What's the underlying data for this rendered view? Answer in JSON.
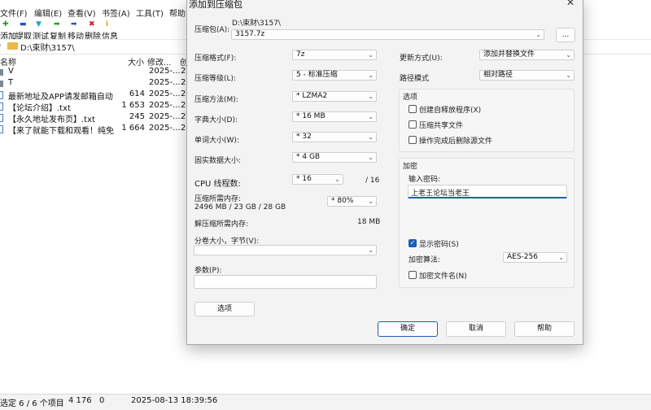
{
  "fm": {
    "menu": [
      "文件(F)",
      "编辑(E)",
      "查看(V)",
      "书签(A)",
      "工具(T)",
      "帮助"
    ],
    "toolbar": [
      "添加",
      "提取",
      "测试",
      "复制",
      "移动",
      "删除",
      "信息"
    ],
    "address": "D:\\束财\\3157\\",
    "columns": {
      "name": "名称",
      "size": "大小",
      "modified": "修改...",
      "created": "创"
    },
    "files": [
      {
        "name": "V",
        "size": "",
        "modified": "2025-...",
        "created": "2"
      },
      {
        "name": "T",
        "size": "",
        "modified": "2025-...",
        "created": "2"
      },
      {
        "name": "最新地址及APP请发邮箱自动...",
        "size": "614",
        "modified": "2025-...",
        "created": "2"
      },
      {
        "name": "【论坛介绍】.txt",
        "size": "1 653",
        "modified": "2025-...",
        "created": "2"
      },
      {
        "name": "【永久地址发布页】.txt",
        "size": "245",
        "modified": "2025-...",
        "created": "2"
      },
      {
        "name": "【来了就能下载和观看！纯免...",
        "size": "1 664",
        "modified": "2025-...",
        "created": "2"
      }
    ],
    "status": {
      "selected": "选定 6 / 6 个项目",
      "size": "4 176",
      "zero": "0",
      "datetime": "2025-08-13 18:39:56"
    }
  },
  "dialog": {
    "title": "添加到压缩包",
    "archive_label": "压缩包(A):",
    "archive_path": "D:\\束财\\3157\\",
    "archive_name": "3157.7z",
    "browse_label": "...",
    "format_label": "压缩格式(F):",
    "format_value": "7z",
    "level_label": "压缩等级(L):",
    "level_value": "5 - 标准压缩",
    "method_label": "压缩方法(M):",
    "method_value": "* LZMA2",
    "dict_label": "字典大小(D):",
    "dict_value": "* 16 MB",
    "word_label": "单词大小(W):",
    "word_value": "* 32",
    "solid_label": "固实数据大小:",
    "solid_value": "* 4 GB",
    "cpu_label": "CPU 线程数:",
    "cpu_value": "* 16",
    "cpu_max": "/ 16",
    "mem_comp_label": "压缩所需内存:",
    "mem_comp_value": "2496 MB / 23 GB / 28 GB",
    "mem_percent": "* 80%",
    "mem_decomp_label": "解压缩所需内存:",
    "mem_decomp_value": "18 MB",
    "split_label": "分卷大小，字节(V):",
    "split_value": "",
    "params_label": "参数(P):",
    "params_value": "",
    "options_button": "选项",
    "update_label": "更新方式(U):",
    "update_value": "添加并替换文件",
    "path_label": "路径模式",
    "path_value": "相对路径",
    "options_group": "选项",
    "opt_sfx": "创建自释放程序(X)",
    "opt_shared": "压缩共享文件",
    "opt_delete": "操作完成后删除源文件",
    "encrypt_group": "加密",
    "password_label": "输入密码:",
    "password_value": "上老王论坛当老王",
    "show_password": "显示密码(S)",
    "algo_label": "加密算法:",
    "algo_value": "AES-256",
    "encrypt_names": "加密文件名(N)",
    "ok": "确定",
    "cancel": "取消",
    "help": "帮助"
  }
}
